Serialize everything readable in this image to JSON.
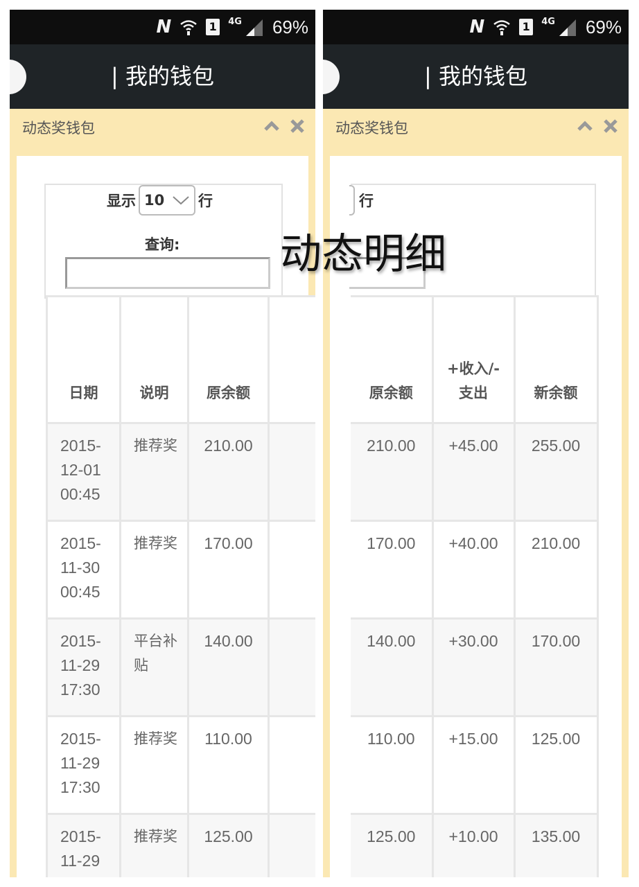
{
  "statusbar": {
    "network_icon": "nfc-n-icon",
    "sim": "1",
    "network_type": "4G",
    "battery": "69%"
  },
  "appbar": {
    "title": "| 我的钱包"
  },
  "panel": {
    "title": "动态奖钱包",
    "collapse_icon": "chevron-up-icon",
    "close_icon": "close-icon"
  },
  "controls": {
    "show_label": "显示",
    "page_length": "10",
    "rows_label": "行",
    "search_label": "查询:",
    "search_value": ""
  },
  "overlay": {
    "title": "动态明细"
  },
  "table": {
    "columns": [
      {
        "key": "date",
        "label": "日期"
      },
      {
        "key": "desc",
        "label": "说明"
      },
      {
        "key": "before",
        "label": "原余额"
      },
      {
        "key": "change",
        "label": "+收入/-支出"
      },
      {
        "key": "after",
        "label": "新余额"
      }
    ],
    "rows": [
      {
        "date": "2015-12-01 00:45",
        "desc": "推荐奖",
        "before": "210.00",
        "change": "+45.00",
        "after": "255.00"
      },
      {
        "date": "2015-11-30 00:45",
        "desc": "推荐奖",
        "before": "170.00",
        "change": "+40.00",
        "after": "210.00"
      },
      {
        "date": "2015-11-29 17:30",
        "desc": "平台补贴",
        "before": "140.00",
        "change": "+30.00",
        "after": "170.00"
      },
      {
        "date": "2015-11-29 17:30",
        "desc": "推荐奖",
        "before": "110.00",
        "change": "+15.00",
        "after": "125.00"
      },
      {
        "date": "2015-11-29",
        "desc": "推荐奖",
        "before": "125.00",
        "change": "+10.00",
        "after": "135.00"
      }
    ]
  },
  "colors": {
    "panel_bg": "#fbe8b3",
    "appbar_bg": "#1f2427",
    "statusbar_bg": "#0e0e0e",
    "row_stripe": "#f7f7f7"
  }
}
